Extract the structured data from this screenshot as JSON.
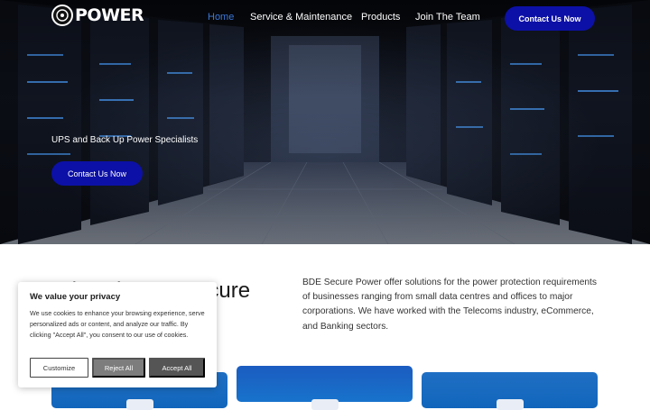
{
  "nav": {
    "logo_text": "POWER",
    "links": [
      {
        "label": "Home",
        "active": true
      },
      {
        "label": "Service & Maintenance",
        "active": false
      },
      {
        "label": "Products",
        "active": false
      },
      {
        "label": "Join The Team",
        "active": false
      }
    ],
    "cta_label": "Contact Us Now"
  },
  "hero": {
    "tagline": "UPS and Back Up Power Specialists",
    "cta_label": "Contact Us Now"
  },
  "about": {
    "heading": "Why Choose Secure Power?",
    "text": "BDE Secure Power offer solutions for the power protection requirements of businesses ranging from small data centres and offices to major corporations. We have worked with the Telecoms industry, eCommerce, and Banking sectors."
  },
  "cookie": {
    "title": "We value your privacy",
    "text": "We use cookies to enhance your browsing experience, serve personalized ads or content, and analyze our traffic. By clicking \"Accept All\", you consent to our use of cookies.",
    "customize_label": "Customize",
    "reject_label": "Reject All",
    "accept_label": "Accept All"
  },
  "colors": {
    "accent": "#0c10a6",
    "nav_active": "#3a78d8",
    "card": "#1166bb"
  }
}
